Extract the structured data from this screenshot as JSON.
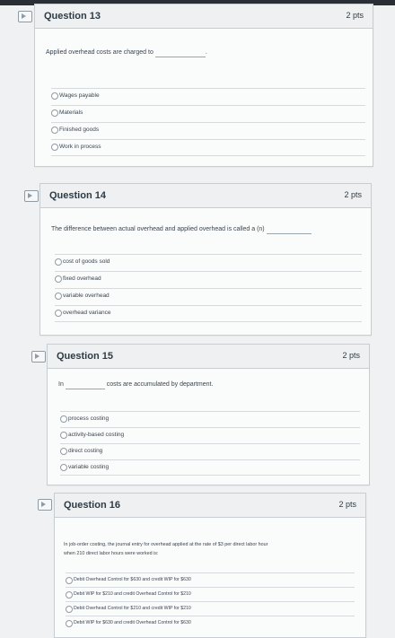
{
  "questions": [
    {
      "title": "Question 13",
      "points": "2 pts",
      "text_before": "Applied overhead costs are charged to",
      "text_after": ".",
      "options": [
        "Wages payable",
        "Materials",
        "Finished goods",
        "Work in process"
      ]
    },
    {
      "title": "Question 14",
      "points": "2 pts",
      "text_before": "The difference between actual overhead and applied overhead is called a (n)",
      "text_after": "",
      "options": [
        "cost of goods sold",
        "fixed overhead",
        "variable overhead",
        "overhead variance"
      ]
    },
    {
      "title": "Question 15",
      "points": "2 pts",
      "text_before": "In",
      "text_after": "costs are accumulated by department.",
      "options": [
        "process costing",
        "activity-based costing",
        "direct costing",
        "variable costing"
      ]
    },
    {
      "title": "Question 16",
      "points": "2 pts",
      "text_line1": "In job-order costing, the journal entry for overhead applied at the rate of $3 per direct labor hour",
      "text_line2": "when 210 direct labor hours were worked is:",
      "options": [
        "Debit Overhead Control for $630 and credit WIP for $630",
        "Debit WIP for $210 and credit Overhead Control for $210",
        "Debit Overhead Control for $210 and credit WIP for $210",
        "Debit WIP for $630 and credit Overhead Control for $630"
      ]
    }
  ]
}
